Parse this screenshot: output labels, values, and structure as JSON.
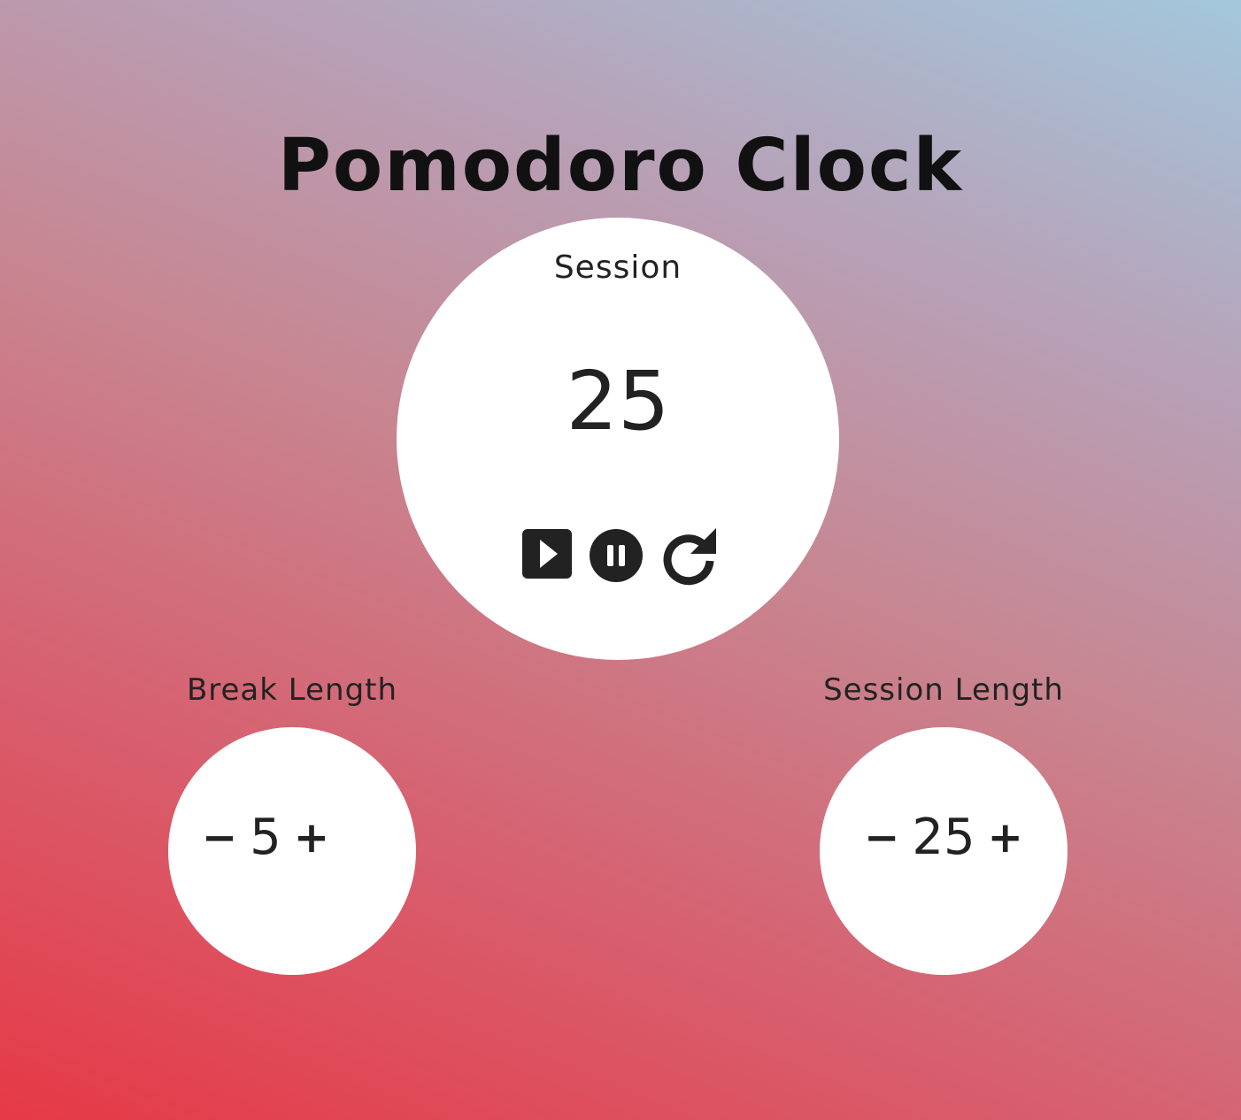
{
  "app": {
    "title": "Pomodoro Clock"
  },
  "timer": {
    "label": "Session",
    "display": "25",
    "controls": {
      "play_icon": "play-icon",
      "pause_icon": "pause-icon",
      "reset_icon": "redo-icon"
    }
  },
  "break_length": {
    "label": "Break Length",
    "decrement": "−",
    "value": "5",
    "increment": "+"
  },
  "session_length": {
    "label": "Session Length",
    "decrement": "−",
    "value": "25",
    "increment": "+"
  },
  "colors": {
    "icon": "#222222",
    "circle": "#ffffff",
    "gradient_start": "#e63946",
    "gradient_end": "#a3c7dc"
  }
}
